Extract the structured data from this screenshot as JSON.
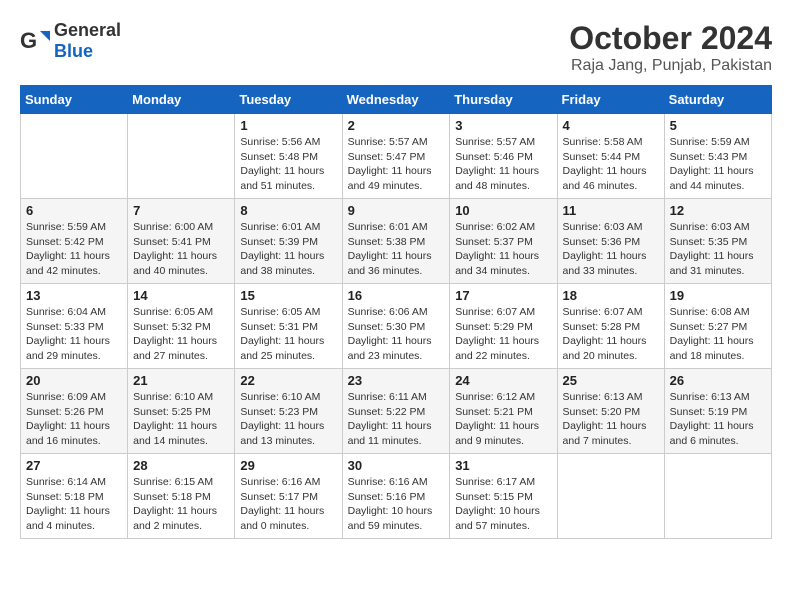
{
  "logo": {
    "general": "General",
    "blue": "Blue"
  },
  "title": "October 2024",
  "location": "Raja Jang, Punjab, Pakistan",
  "days_of_week": [
    "Sunday",
    "Monday",
    "Tuesday",
    "Wednesday",
    "Thursday",
    "Friday",
    "Saturday"
  ],
  "weeks": [
    [
      {
        "day": "",
        "info": ""
      },
      {
        "day": "",
        "info": ""
      },
      {
        "day": "1",
        "info": "Sunrise: 5:56 AM\nSunset: 5:48 PM\nDaylight: 11 hours and 51 minutes."
      },
      {
        "day": "2",
        "info": "Sunrise: 5:57 AM\nSunset: 5:47 PM\nDaylight: 11 hours and 49 minutes."
      },
      {
        "day": "3",
        "info": "Sunrise: 5:57 AM\nSunset: 5:46 PM\nDaylight: 11 hours and 48 minutes."
      },
      {
        "day": "4",
        "info": "Sunrise: 5:58 AM\nSunset: 5:44 PM\nDaylight: 11 hours and 46 minutes."
      },
      {
        "day": "5",
        "info": "Sunrise: 5:59 AM\nSunset: 5:43 PM\nDaylight: 11 hours and 44 minutes."
      }
    ],
    [
      {
        "day": "6",
        "info": "Sunrise: 5:59 AM\nSunset: 5:42 PM\nDaylight: 11 hours and 42 minutes."
      },
      {
        "day": "7",
        "info": "Sunrise: 6:00 AM\nSunset: 5:41 PM\nDaylight: 11 hours and 40 minutes."
      },
      {
        "day": "8",
        "info": "Sunrise: 6:01 AM\nSunset: 5:39 PM\nDaylight: 11 hours and 38 minutes."
      },
      {
        "day": "9",
        "info": "Sunrise: 6:01 AM\nSunset: 5:38 PM\nDaylight: 11 hours and 36 minutes."
      },
      {
        "day": "10",
        "info": "Sunrise: 6:02 AM\nSunset: 5:37 PM\nDaylight: 11 hours and 34 minutes."
      },
      {
        "day": "11",
        "info": "Sunrise: 6:03 AM\nSunset: 5:36 PM\nDaylight: 11 hours and 33 minutes."
      },
      {
        "day": "12",
        "info": "Sunrise: 6:03 AM\nSunset: 5:35 PM\nDaylight: 11 hours and 31 minutes."
      }
    ],
    [
      {
        "day": "13",
        "info": "Sunrise: 6:04 AM\nSunset: 5:33 PM\nDaylight: 11 hours and 29 minutes."
      },
      {
        "day": "14",
        "info": "Sunrise: 6:05 AM\nSunset: 5:32 PM\nDaylight: 11 hours and 27 minutes."
      },
      {
        "day": "15",
        "info": "Sunrise: 6:05 AM\nSunset: 5:31 PM\nDaylight: 11 hours and 25 minutes."
      },
      {
        "day": "16",
        "info": "Sunrise: 6:06 AM\nSunset: 5:30 PM\nDaylight: 11 hours and 23 minutes."
      },
      {
        "day": "17",
        "info": "Sunrise: 6:07 AM\nSunset: 5:29 PM\nDaylight: 11 hours and 22 minutes."
      },
      {
        "day": "18",
        "info": "Sunrise: 6:07 AM\nSunset: 5:28 PM\nDaylight: 11 hours and 20 minutes."
      },
      {
        "day": "19",
        "info": "Sunrise: 6:08 AM\nSunset: 5:27 PM\nDaylight: 11 hours and 18 minutes."
      }
    ],
    [
      {
        "day": "20",
        "info": "Sunrise: 6:09 AM\nSunset: 5:26 PM\nDaylight: 11 hours and 16 minutes."
      },
      {
        "day": "21",
        "info": "Sunrise: 6:10 AM\nSunset: 5:25 PM\nDaylight: 11 hours and 14 minutes."
      },
      {
        "day": "22",
        "info": "Sunrise: 6:10 AM\nSunset: 5:23 PM\nDaylight: 11 hours and 13 minutes."
      },
      {
        "day": "23",
        "info": "Sunrise: 6:11 AM\nSunset: 5:22 PM\nDaylight: 11 hours and 11 minutes."
      },
      {
        "day": "24",
        "info": "Sunrise: 6:12 AM\nSunset: 5:21 PM\nDaylight: 11 hours and 9 minutes."
      },
      {
        "day": "25",
        "info": "Sunrise: 6:13 AM\nSunset: 5:20 PM\nDaylight: 11 hours and 7 minutes."
      },
      {
        "day": "26",
        "info": "Sunrise: 6:13 AM\nSunset: 5:19 PM\nDaylight: 11 hours and 6 minutes."
      }
    ],
    [
      {
        "day": "27",
        "info": "Sunrise: 6:14 AM\nSunset: 5:18 PM\nDaylight: 11 hours and 4 minutes."
      },
      {
        "day": "28",
        "info": "Sunrise: 6:15 AM\nSunset: 5:18 PM\nDaylight: 11 hours and 2 minutes."
      },
      {
        "day": "29",
        "info": "Sunrise: 6:16 AM\nSunset: 5:17 PM\nDaylight: 11 hours and 0 minutes."
      },
      {
        "day": "30",
        "info": "Sunrise: 6:16 AM\nSunset: 5:16 PM\nDaylight: 10 hours and 59 minutes."
      },
      {
        "day": "31",
        "info": "Sunrise: 6:17 AM\nSunset: 5:15 PM\nDaylight: 10 hours and 57 minutes."
      },
      {
        "day": "",
        "info": ""
      },
      {
        "day": "",
        "info": ""
      }
    ]
  ]
}
